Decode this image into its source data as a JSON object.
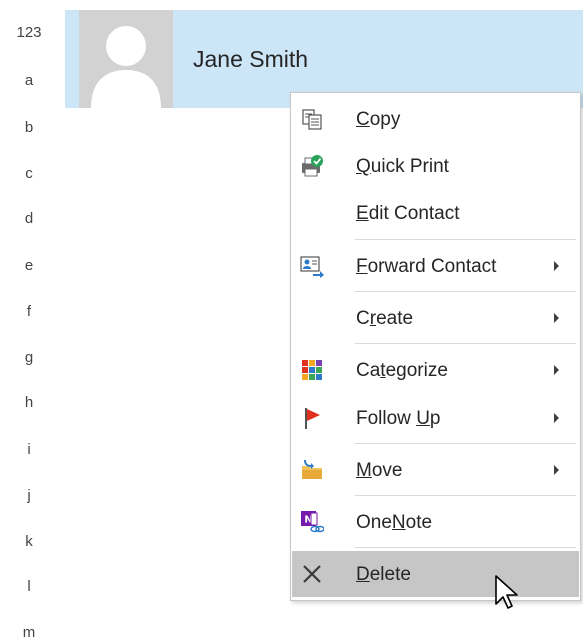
{
  "index": [
    "123",
    "a",
    "b",
    "c",
    "d",
    "e",
    "f",
    "g",
    "h",
    "i",
    "j",
    "k",
    "l",
    "m"
  ],
  "contact": {
    "name": "Jane Smith"
  },
  "menu": {
    "items": [
      {
        "label": "Copy",
        "accel": "C",
        "icon": "copy-icon",
        "submenu": false
      },
      {
        "label": "Quick Print",
        "accel": "Q",
        "icon": "quick-print-icon",
        "submenu": false
      },
      {
        "label": "Edit Contact",
        "accel": "E",
        "icon": "",
        "submenu": false
      },
      {
        "label": "Forward Contact",
        "accel": "F",
        "icon": "forward-contact-icon",
        "submenu": true
      },
      {
        "label": "Create",
        "accel": "r",
        "icon": "",
        "submenu": true
      },
      {
        "label": "Categorize",
        "accel": "t",
        "icon": "categorize-icon",
        "submenu": true
      },
      {
        "label": "Follow Up",
        "accel": "U",
        "icon": "follow-up-flag-icon",
        "submenu": true
      },
      {
        "label": "Move",
        "accel": "M",
        "icon": "move-folder-icon",
        "submenu": true
      },
      {
        "label": "OneNote",
        "accel": "N",
        "icon": "onenote-icon",
        "submenu": false
      },
      {
        "label": "Delete",
        "accel": "D",
        "icon": "delete-x-icon",
        "submenu": false,
        "highlighted": true
      }
    ]
  },
  "colors": {
    "selected_card": "#cde6f7",
    "menu_highlight": "#c6c6c6",
    "flag_red": "#e0301e",
    "onenote_purple": "#7719aa"
  }
}
